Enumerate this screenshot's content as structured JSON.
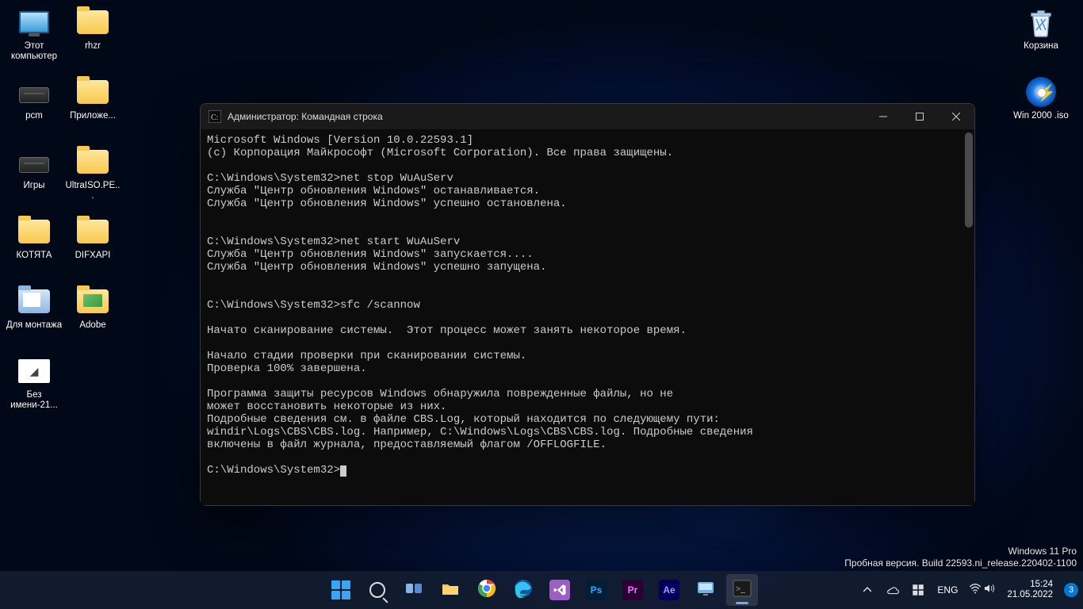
{
  "desktop_icons": {
    "col1": [
      {
        "label": "Этот\nкомпьютер",
        "type": "monitor"
      },
      {
        "label": "pcm",
        "type": "drive"
      },
      {
        "label": "Игры",
        "type": "drive"
      },
      {
        "label": "КОТЯТА",
        "type": "folder"
      },
      {
        "label": "Для\nмонтажа",
        "type": "docfolder"
      },
      {
        "label": "Без\nимени-21...",
        "type": "bmp"
      }
    ],
    "col2": [
      {
        "label": "rhzr",
        "type": "folder"
      },
      {
        "label": "Приложе...",
        "type": "folder"
      },
      {
        "label": "UltraISO.PE...",
        "type": "folder"
      },
      {
        "label": "DIFXAPI",
        "type": "folder"
      },
      {
        "label": "Adobe",
        "type": "imgfolder"
      }
    ],
    "right": [
      {
        "label": "Корзина",
        "type": "recycle"
      },
      {
        "label": "Win 2000 .iso",
        "type": "disc"
      }
    ]
  },
  "cmd": {
    "title": "Администратор: Командная строка",
    "lines": [
      "Microsoft Windows [Version 10.0.22593.1]",
      "(c) Корпорация Майкрософт (Microsoft Corporation). Все права защищены.",
      "",
      "C:\\Windows\\System32>net stop WuAuServ",
      "Служба \"Центр обновления Windows\" останавливается.",
      "Служба \"Центр обновления Windows\" успешно остановлена.",
      "",
      "",
      "C:\\Windows\\System32>net start WuAuServ",
      "Служба \"Центр обновления Windows\" запускается....",
      "Служба \"Центр обновления Windows\" успешно запущена.",
      "",
      "",
      "C:\\Windows\\System32>sfc /scannow",
      "",
      "Начато сканирование системы.  Этот процесс может занять некоторое время.",
      "",
      "Начало стадии проверки при сканировании системы.",
      "Проверка 100% завершена.",
      "",
      "Программа защиты ресурсов Windows обнаружила поврежденные файлы, но не",
      "может восстановить некоторые из них.",
      "Подробные сведения см. в файле CBS.Log, который находится по следующему пути:",
      "windir\\Logs\\CBS\\CBS.log. Например, C:\\Windows\\Logs\\CBS\\CBS.log. Подробные сведения",
      "включены в файл журнала, предоставляемый флагом /OFFLOGFILE.",
      ""
    ],
    "prompt": "C:\\Windows\\System32>"
  },
  "watermark": {
    "line1": "Windows 11 Pro",
    "line2": "Пробная версия. Build 22593.ni_release.220402-1100"
  },
  "taskbar": {
    "apps": [
      {
        "name": "start",
        "type": "start"
      },
      {
        "name": "search",
        "type": "search"
      },
      {
        "name": "taskview",
        "bg": "transparent",
        "render": "taskview"
      },
      {
        "name": "explorer",
        "render": "explorer"
      },
      {
        "name": "chrome",
        "render": "chrome"
      },
      {
        "name": "edge",
        "render": "edge"
      },
      {
        "name": "visualstudio",
        "bg": "#9b5ec2",
        "text": ""
      },
      {
        "name": "photoshop",
        "bg": "#001e36",
        "text": "Ps",
        "tc": "#31a8ff"
      },
      {
        "name": "premiere",
        "bg": "#2a0034",
        "text": "Pr",
        "tc": "#ea77ff"
      },
      {
        "name": "aftereffects",
        "bg": "#00005b",
        "text": "Ae",
        "tc": "#9999ff"
      },
      {
        "name": "monitor-app",
        "render": "monitor"
      },
      {
        "name": "cmd",
        "render": "cmd",
        "active": true
      }
    ],
    "lang": "ENG",
    "time": "15:24",
    "date": "21.05.2022",
    "notif_count": "3"
  }
}
